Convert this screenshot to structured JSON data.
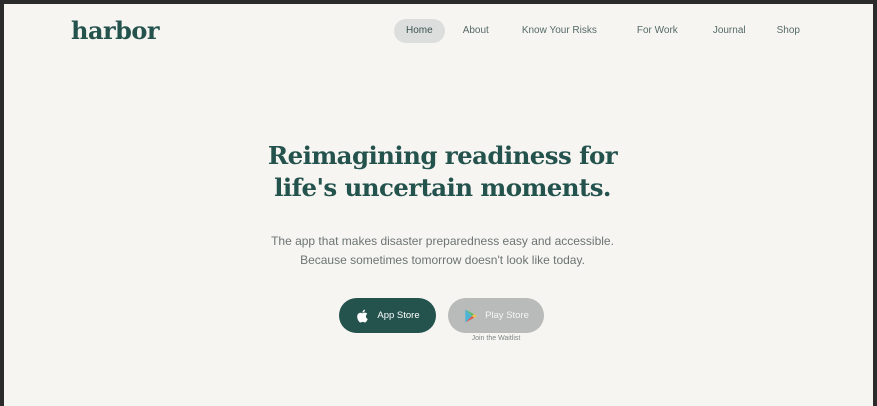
{
  "brand": {
    "logo_text": "harbor"
  },
  "nav": {
    "items": [
      {
        "label": "Home",
        "active": true
      },
      {
        "label": "About",
        "active": false
      },
      {
        "label": "Know Your Risks",
        "active": false
      },
      {
        "label": "For Work",
        "active": false
      },
      {
        "label": "Journal",
        "active": false
      },
      {
        "label": "Shop",
        "active": false
      }
    ]
  },
  "hero": {
    "headline_line1": "Reimagining readiness for",
    "headline_line2": "life's uncertain moments.",
    "subtext_line1": "The app that makes disaster preparedness easy and accessible.",
    "subtext_line2": "Because sometimes tomorrow doesn't look like today."
  },
  "cta": {
    "app_store_label": "App Store",
    "app_store_icon": "apple-icon",
    "play_store_label": "Play Store",
    "play_store_icon": "google-play-icon",
    "waitlist_label": "Join the Waitlist"
  },
  "colors": {
    "brand": "#24524d",
    "background": "#f7f5f2",
    "nav_active_bg": "#dcdedd",
    "disabled_button": "#b9bbba"
  }
}
